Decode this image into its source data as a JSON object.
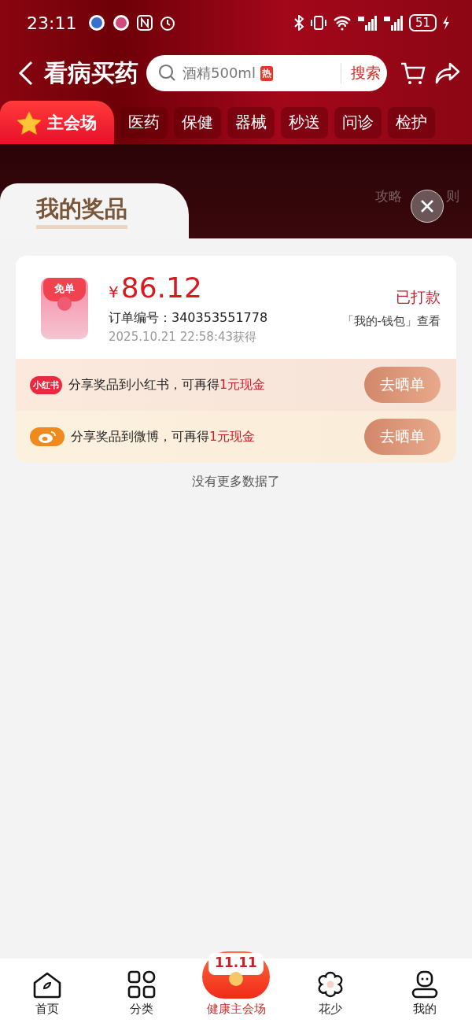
{
  "status_bar": {
    "time": "23:11",
    "battery": "51"
  },
  "header": {
    "title": "看病买药",
    "search": {
      "placeholder": "酒精500ml",
      "hot_badge": "热",
      "button": "搜索"
    }
  },
  "tabs": [
    {
      "label": "主会场",
      "selected": true
    },
    {
      "label": "医药",
      "selected": false
    },
    {
      "label": "保健",
      "selected": false
    },
    {
      "label": "器械",
      "selected": false
    },
    {
      "label": "秒送",
      "selected": false
    },
    {
      "label": "问诊",
      "selected": false
    },
    {
      "label": "检护",
      "selected": false
    }
  ],
  "banner": {
    "links": [
      "攻略",
      "则"
    ]
  },
  "prize_panel": {
    "title": "我的奖品",
    "prizes": [
      {
        "badge": "免单",
        "currency": "¥",
        "amount": "86.12",
        "order_label": "订单编号：",
        "order_no": "340353551778",
        "obtained": "2025.10.21 22:58:43获得",
        "status": "已打款",
        "wallet_hint": "「我的-钱包」查看",
        "shares": [
          {
            "kind": "xiaohongshu",
            "logo": "小红书",
            "text": "分享奖品到小红书，可再得",
            "reward": "1元现金",
            "button": "去晒单"
          },
          {
            "kind": "weibo",
            "text": "分享奖品到微博，可再得",
            "reward": "1元现金",
            "button": "去晒单"
          }
        ]
      }
    ],
    "footer_note": "没有更多数据了"
  },
  "bottom_nav": [
    {
      "kind": "home",
      "label": "首页",
      "selected": false
    },
    {
      "kind": "category",
      "label": "分类",
      "selected": false
    },
    {
      "kind": "promo",
      "label": "健康主会场",
      "badge": "11.11",
      "selected": true
    },
    {
      "kind": "flower",
      "label": "花少",
      "selected": false
    },
    {
      "kind": "profile",
      "label": "我的",
      "selected": false
    }
  ]
}
